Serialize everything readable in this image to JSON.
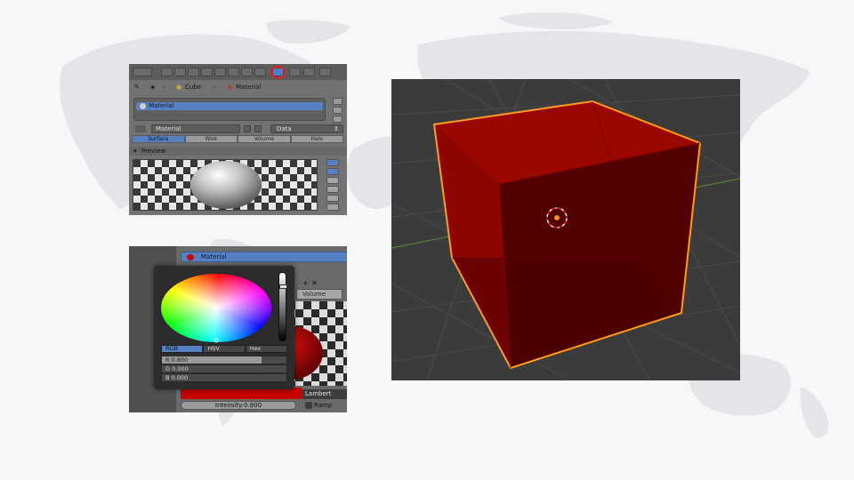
{
  "properties_panel": {
    "breadcrumb": {
      "object": "Cube",
      "material": "Material"
    },
    "material_slot": "Material",
    "material_name": "Material",
    "data_field": "Data",
    "surface_tabs": [
      "Surface",
      "Wire",
      "Volume",
      "Halo"
    ],
    "active_surface_tab": "Surface",
    "preview_header": "Preview",
    "highlight_color": "#e02020"
  },
  "color_panel": {
    "material_header": "Material",
    "picker_modes": [
      "RGB",
      "HSV",
      "Hex"
    ],
    "active_mode": "RGB",
    "values": {
      "r": "R 0.800",
      "g": "G 0.000",
      "b": "B 0.000"
    },
    "volume_tab": "Volume",
    "diffuse_color": "#c80000",
    "shader": "Lambert",
    "intensity": "Intensity:0.800",
    "ramp": "Ramp"
  },
  "viewport": {
    "cube_color": "#8a0500",
    "selection_outline": "#ff9a1f",
    "background": "#3b3b3b"
  }
}
